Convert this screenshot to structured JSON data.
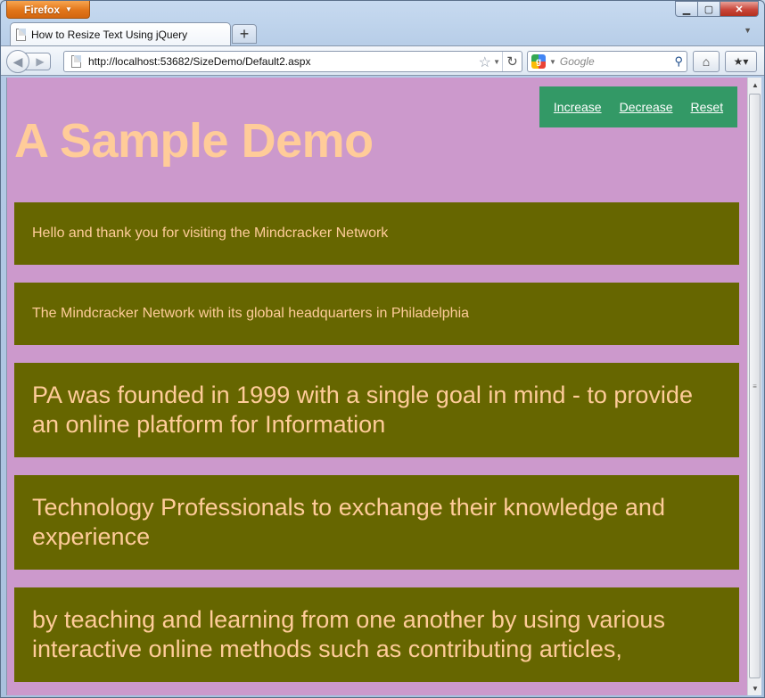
{
  "browser": {
    "app_button_label": "Firefox",
    "tab_title": "How to Resize Text Using jQuery",
    "new_tab_label": "+",
    "url": "http://localhost:53682/SizeDemo/Default2.aspx",
    "search_placeholder": "Google"
  },
  "page": {
    "heading": "A Sample Demo",
    "toolbar": {
      "increase_label": "Increase",
      "decrease_label": "Decrease",
      "reset_label": "Reset"
    },
    "paragraphs": [
      "Hello and thank you for visiting the Mindcracker Network",
      "The Mindcracker Network with its global headquarters in Philadelphia",
      "PA was founded in 1999 with a single goal in mind - to provide an online platform for Information",
      "Technology Professionals to exchange their knowledge and experience",
      "by teaching and learning from one another by using various interactive online methods such as contributing articles,"
    ]
  },
  "colors": {
    "page_background": "#cc99cc",
    "heading_text": "#ffcc99",
    "paragraph_background": "#666600",
    "toolbar_background": "#339966",
    "toolbar_link": "#ffffff"
  },
  "icons": {
    "back": "back-arrow-icon",
    "forward": "forward-arrow-icon",
    "bookmark_star": "star-icon",
    "reload": "reload-icon",
    "search_engine": "google-icon",
    "search": "magnifier-icon",
    "home": "home-icon",
    "bookmarks": "bookmarks-icon"
  }
}
